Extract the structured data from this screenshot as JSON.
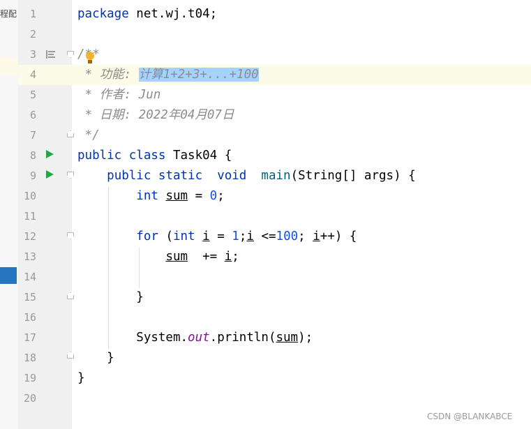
{
  "tool_window": {
    "label": "程配"
  },
  "editor": {
    "lines": [
      {
        "num": "1",
        "parts": [
          {
            "t": "package",
            "k": "kw"
          },
          {
            "t": " net.wj.t04;"
          }
        ]
      },
      {
        "num": "2",
        "parts": []
      },
      {
        "num": "3",
        "parts": [
          {
            "t": "/**",
            "k": "cmt"
          }
        ]
      },
      {
        "num": "4",
        "parts": [
          {
            "t": " * 功能: ",
            "k": "cmt"
          },
          {
            "t": "计算1+2+3+...+100",
            "k": "cmt sel"
          }
        ]
      },
      {
        "num": "5",
        "parts": [
          {
            "t": " * 作者: Jun",
            "k": "cmt"
          }
        ]
      },
      {
        "num": "6",
        "parts": [
          {
            "t": " * 日期: 2022年04月07日",
            "k": "cmt"
          }
        ]
      },
      {
        "num": "7",
        "parts": [
          {
            "t": " */",
            "k": "cmt"
          }
        ]
      },
      {
        "num": "8",
        "parts": [
          {
            "t": "public class",
            "k": "kw"
          },
          {
            "t": " Task04 {"
          }
        ]
      },
      {
        "num": "9",
        "parts": [
          {
            "t": "    "
          },
          {
            "t": "public static  void",
            "k": "kw"
          },
          {
            "t": "  "
          },
          {
            "t": "main",
            "k": "meth"
          },
          {
            "t": "(String[] args) {"
          }
        ]
      },
      {
        "num": "10",
        "parts": [
          {
            "t": "        "
          },
          {
            "t": "int",
            "k": "kw"
          },
          {
            "t": " "
          },
          {
            "t": "sum",
            "k": "ul"
          },
          {
            "t": " = "
          },
          {
            "t": "0",
            "k": "num"
          },
          {
            "t": ";"
          }
        ]
      },
      {
        "num": "11",
        "parts": []
      },
      {
        "num": "12",
        "parts": [
          {
            "t": "        "
          },
          {
            "t": "for",
            "k": "kw"
          },
          {
            "t": " ("
          },
          {
            "t": "int",
            "k": "kw"
          },
          {
            "t": " "
          },
          {
            "t": "i",
            "k": "ul"
          },
          {
            "t": " = "
          },
          {
            "t": "1",
            "k": "num"
          },
          {
            "t": ";"
          },
          {
            "t": "i",
            "k": "ul"
          },
          {
            "t": " <="
          },
          {
            "t": "100",
            "k": "num"
          },
          {
            "t": "; "
          },
          {
            "t": "i",
            "k": "ul"
          },
          {
            "t": "++) {"
          }
        ]
      },
      {
        "num": "13",
        "parts": [
          {
            "t": "            "
          },
          {
            "t": "sum",
            "k": "ul"
          },
          {
            "t": "  += "
          },
          {
            "t": "i",
            "k": "ul"
          },
          {
            "t": ";"
          }
        ]
      },
      {
        "num": "14",
        "parts": []
      },
      {
        "num": "15",
        "parts": [
          {
            "t": "        }"
          }
        ]
      },
      {
        "num": "16",
        "parts": []
      },
      {
        "num": "17",
        "parts": [
          {
            "t": "        System."
          },
          {
            "t": "out",
            "k": "stat"
          },
          {
            "t": ".println("
          },
          {
            "t": "sum",
            "k": "ul"
          },
          {
            "t": ");"
          }
        ]
      },
      {
        "num": "18",
        "parts": [
          {
            "t": "    }"
          }
        ]
      },
      {
        "num": "19",
        "parts": [
          {
            "t": "}"
          }
        ]
      },
      {
        "num": "20",
        "parts": []
      }
    ]
  },
  "watermark": "CSDN @BLANKABCE",
  "colors": {
    "keyword": "#0033b3",
    "number": "#1750eb",
    "method": "#00627a",
    "static_field": "#871094",
    "comment": "#8c8c8c",
    "selection": "#a6d2ff",
    "run_icon": "#23a745",
    "bulb": "#f2b42c"
  },
  "icons": {
    "run_lines": [
      "8",
      "9"
    ],
    "fold_lines": [
      "3",
      "7",
      "9",
      "12",
      "15",
      "18"
    ],
    "doc_line": "3",
    "bulb_line": "3"
  }
}
